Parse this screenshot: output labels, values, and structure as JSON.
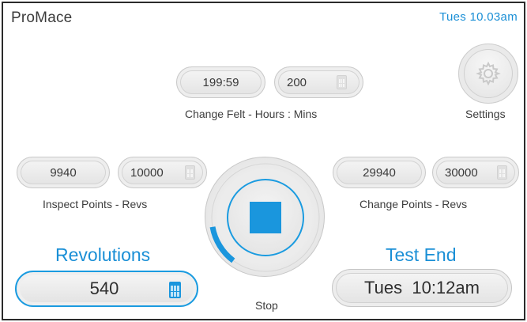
{
  "header": {
    "app_title": "ProMace",
    "clock": "Tues  10.03am"
  },
  "change_felt": {
    "time_value": "199:59",
    "setting_value": "200",
    "caption": "Change Felt - Hours : Mins"
  },
  "settings": {
    "label": "Settings",
    "icon": "gear-icon"
  },
  "inspect_points": {
    "current_value": "9940",
    "setting_value": "10000",
    "caption": "Inspect Points - Revs",
    "icon": "calculator-icon"
  },
  "change_points": {
    "current_value": "29940",
    "setting_value": "30000",
    "caption": "Change Points - Revs",
    "icon": "calculator-icon"
  },
  "control": {
    "label": "Stop",
    "icon": "stop-icon",
    "progress_fraction": 0.12,
    "accent_color": "#1a96dd"
  },
  "revolutions": {
    "title": "Revolutions",
    "value": "540",
    "icon": "calculator-icon"
  },
  "test_end": {
    "title": "Test End",
    "value": "Tues  10:12am"
  }
}
